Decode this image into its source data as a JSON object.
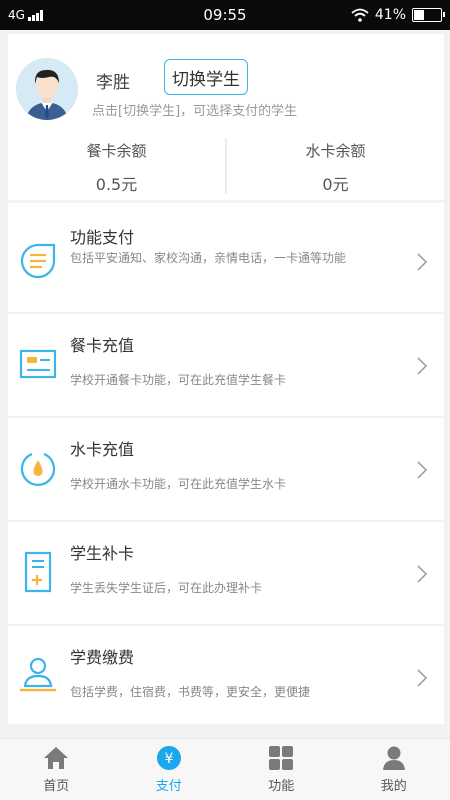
{
  "status_bar": {
    "network": "4G",
    "time": "09:55",
    "battery": "41%",
    "battery_level": 0.41
  },
  "profile": {
    "name": "李胜",
    "switch_label": "切换学生",
    "hint": "点击[切换学生]，可选择支付的学生"
  },
  "balances": [
    {
      "label": "餐卡余额",
      "value": "0.5元"
    },
    {
      "label": "水卡余额",
      "value": "0元"
    }
  ],
  "menu": [
    {
      "title": "功能支付",
      "desc": "包括平安通知、家校沟通，亲情电话，一卡通等功能",
      "icon": "feature-pay-icon"
    },
    {
      "title": "餐卡充值",
      "desc": "学校开通餐卡功能，可在此充值学生餐卡",
      "icon": "meal-card-icon"
    },
    {
      "title": "水卡充值",
      "desc": "学校开通水卡功能，可在此充值学生水卡",
      "icon": "water-card-icon"
    },
    {
      "title": "学生补卡",
      "desc": "学生丢失学生证后，可在此办理补卡",
      "icon": "reissue-card-icon"
    },
    {
      "title": "学费缴费",
      "desc": "包括学费，住宿费，书费等，更安全，更便捷",
      "icon": "tuition-icon"
    }
  ],
  "nav": [
    {
      "label": "首页",
      "icon": "home-icon"
    },
    {
      "label": "支付",
      "icon": "yuan-icon",
      "active": true
    },
    {
      "label": "功能",
      "icon": "grid-icon"
    },
    {
      "label": "我的",
      "icon": "user-icon"
    }
  ],
  "colors": {
    "accent": "#3bb4ea",
    "active": "#1aa7ec",
    "orange": "#f5b73b"
  }
}
